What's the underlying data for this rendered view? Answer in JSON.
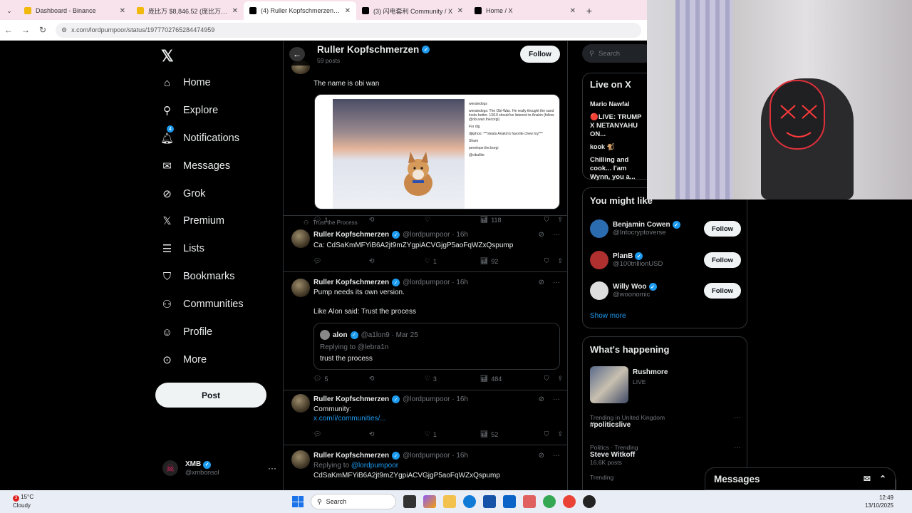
{
  "browser": {
    "tabs": [
      {
        "title": "Dashboard - Binance",
        "color": "#f0b90b",
        "active": false
      },
      {
        "title": "庞比万 $8,846.52 (庞比万) - An",
        "color": "#f0b90b",
        "active": false
      },
      {
        "title": "(4) Ruller Kopfschmerzen on X:",
        "color": "#000000",
        "active": true
      },
      {
        "title": "(3) 闪电套利 Community / X",
        "color": "#000000",
        "active": false
      },
      {
        "title": "Home / X",
        "color": "#000000",
        "active": false
      }
    ],
    "url": "x.com/lordpumpoor/status/1977702765284474959"
  },
  "sidebar": {
    "items": [
      {
        "label": "Home",
        "icon": "home-icon",
        "glyph": "⌂"
      },
      {
        "label": "Explore",
        "icon": "search-icon",
        "glyph": "⚲"
      },
      {
        "label": "Notifications",
        "icon": "bell-icon",
        "glyph": "🔔︎",
        "badge": "4"
      },
      {
        "label": "Messages",
        "icon": "mail-icon",
        "glyph": "✉"
      },
      {
        "label": "Grok",
        "icon": "grok-icon",
        "glyph": "⊘"
      },
      {
        "label": "Premium",
        "icon": "x-logo-icon",
        "glyph": "𝕏"
      },
      {
        "label": "Lists",
        "icon": "list-icon",
        "glyph": "☰"
      },
      {
        "label": "Bookmarks",
        "icon": "bookmark-icon",
        "glyph": "⛉"
      },
      {
        "label": "Communities",
        "icon": "communities-icon",
        "glyph": "⚇"
      },
      {
        "label": "Profile",
        "icon": "person-icon",
        "glyph": "☺"
      },
      {
        "label": "More",
        "icon": "more-icon",
        "glyph": "⊙"
      }
    ],
    "post_label": "Post",
    "account": {
      "name": "XMB",
      "handle": "@xmbonsol"
    }
  },
  "header": {
    "name": "Ruller Kopfschmerzen",
    "posts": "59 posts",
    "follow": "Follow"
  },
  "tweets": [
    {
      "text": "The name is obi wan",
      "reply": "1",
      "repost": "",
      "like": "",
      "views": "118"
    },
    {
      "pinned": "Trust the Process",
      "name": "Ruller Kopfschmerzen",
      "handle": "@lordpumpoor · 16h",
      "text": "Ca: CdSaKmMFYiB6A2jt9mZYgpiACVGjgP5aoFqWZxQspump",
      "reply": "",
      "repost": "",
      "like": "1",
      "views": "92"
    },
    {
      "name": "Ruller Kopfschmerzen",
      "handle": "@lordpumpoor · 16h",
      "text": "Pump needs its own version.",
      "text2": "Like Alon said: Trust the process",
      "quote": {
        "name": "alon",
        "handle": "@a1lon9 · Mar 25",
        "replying": "Replying to @lebra1n",
        "text": "trust the process"
      },
      "reply": "5",
      "repost": "",
      "like": "3",
      "views": "484"
    },
    {
      "name": "Ruller Kopfschmerzen",
      "handle": "@lordpumpoor · 16h",
      "text": "Community:",
      "link": "x.com/i/communities/...",
      "reply": "",
      "repost": "",
      "like": "1",
      "views": "52"
    },
    {
      "name": "Ruller Kopfschmerzen",
      "handle": "@lordpumpoor · 16h",
      "replying_prefix": "Replying to",
      "replying_handle": "@lordpumpoor",
      "text": "CdSaKmMFYiB6A2jt9mZYgpiACVGjgP5aoFqWZxQspump"
    }
  ],
  "media": {
    "shot": [
      "weratedogs",
      "weratedogs: The Obi-Wan. He really thought the sand looks better. 13/10 should've listened to Anakin (follow @obi.wan.thecorgi)",
      "For dig",
      "djkphoo: ***steals Anakin's favorite chew toy***",
      "Share",
      "penelope.the.borgi",
      "@cibullite"
    ]
  },
  "right": {
    "search": "Search",
    "live_title": "Live on X",
    "live": [
      {
        "name": "Mario Nawfal",
        "text": "🔴LIVE: TRUMP X NETANYAHU ON..."
      },
      {
        "name": "kook 🐒",
        "text": "Chilling and cook... I'am Wynn, you a..."
      }
    ],
    "might_like_title": "You might like",
    "suggestions": [
      {
        "name": "Benjamin Cowen",
        "handle": "@Intocryptoverse",
        "color": "#2b6cb0"
      },
      {
        "name": "PlanB",
        "handle": "@100trillionUSD",
        "color": "#b03030"
      },
      {
        "name": "Willy Woo",
        "handle": "@woonomic",
        "color": "#dddddd"
      }
    ],
    "follow": "Follow",
    "show_more": "Show more",
    "happening_title": "What's happening",
    "event": {
      "name": "Rushmore",
      "status": "LIVE"
    },
    "trends": [
      {
        "cat": "Trending in United Kingdom",
        "title": "#politicslive",
        "count": ""
      },
      {
        "cat": "Politics · Trending",
        "title": "Steve Witkoff",
        "count": "16.6K posts"
      },
      {
        "cat": "Trending",
        "title": "",
        "count": ""
      }
    ]
  },
  "messages_label": "Messages",
  "taskbar": {
    "temp": "15°C",
    "weather": "Cloudy",
    "search": "Search",
    "time": "12:49",
    "date": "13/10/2025",
    "weather_badge": "3"
  }
}
